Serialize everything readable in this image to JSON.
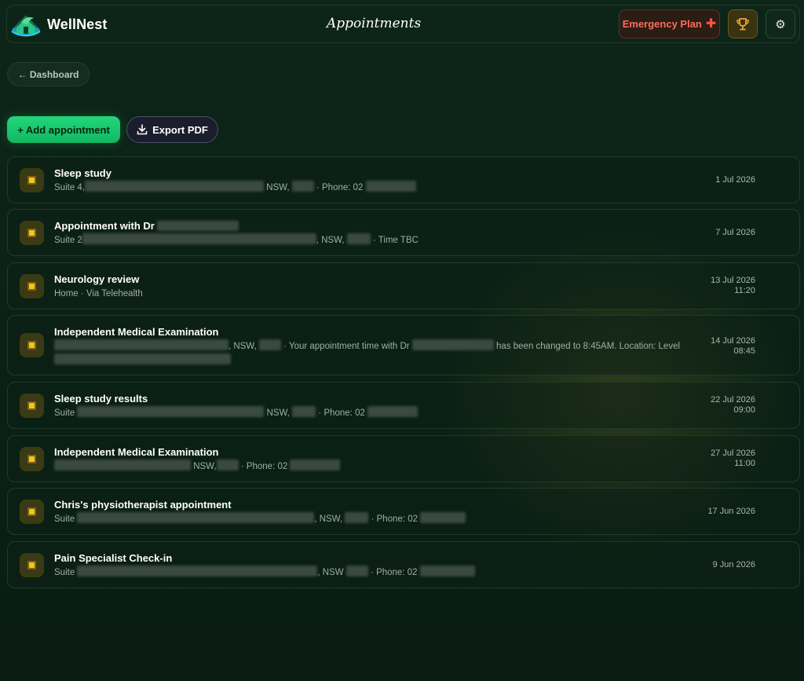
{
  "header": {
    "brand": "WellNest",
    "page_title": "Appointments",
    "emergency_label": "Emergency Plan",
    "emergency_icon": "plus-cross-icon",
    "trophy_icon": "trophy-icon",
    "settings_icon": "gear-icon",
    "colors": {
      "emergency": "#ff6b5c",
      "trophy": "#f0a531",
      "accent": "#1ec872"
    }
  },
  "nav": {
    "back_label": "← Dashboard"
  },
  "actions": {
    "add_label": "+ Add appointment",
    "export_label": "Export PDF",
    "export_icon": "download-icon"
  },
  "appointments": [
    {
      "title": "Sleep study",
      "date": "1 Jul 2026",
      "time": "",
      "sub_parts": [
        "Suite 4,",
        " NSW,",
        " · Phone: 02 "
      ]
    },
    {
      "title": "Appointment with Dr ",
      "date": "7 Jul 2026",
      "time": "",
      "sub_parts": [
        "Suite 2",
        ", NSW,",
        " · Time TBC"
      ]
    },
    {
      "title": "Neurology review",
      "date": "13 Jul 2026",
      "time": "11:20",
      "sub_parts": [
        "Home · Via Telehealth"
      ]
    },
    {
      "title": "Independent Medical Examination",
      "date": "14 Jul 2026",
      "time": "08:45",
      "sub_parts": [
        ", NSW,",
        " · Your appointment time with Dr ",
        " has been changed to 8:45AM. Location: Level"
      ]
    },
    {
      "title": "Sleep study results",
      "date": "22 Jul 2026",
      "time": "09:00",
      "sub_parts": [
        "Suite ",
        " NSW,",
        " · Phone: 02 "
      ]
    },
    {
      "title": "Independent Medical Examination",
      "date": "27 Jul 2026",
      "time": "11:00",
      "sub_parts": [
        " NSW,",
        " · Phone: 02 "
      ]
    },
    {
      "title": "Chris's physiotherapist appointment",
      "date": "17 Jun 2026",
      "time": "",
      "sub_parts": [
        "Suite ",
        ", NSW,",
        " · Phone: 02 "
      ]
    },
    {
      "title": "Pain Specialist Check-in",
      "date": "9 Jun 2026",
      "time": "",
      "sub_parts": [
        "Suite ",
        ", NSW ",
        " · Phone: 02 "
      ]
    }
  ]
}
